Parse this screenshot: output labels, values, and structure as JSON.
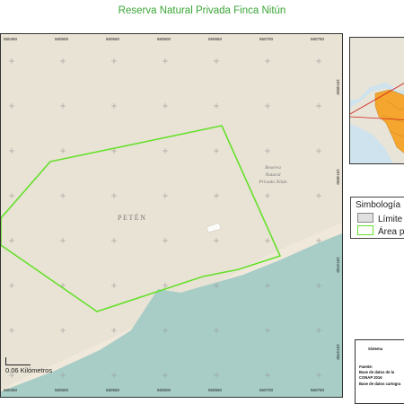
{
  "title": "Reserva Natural Privada Finca Nitún",
  "colors": {
    "title": "#3aa536",
    "land": "#e9e3d5",
    "water": "#a7cdc6",
    "boundary": "#66e02b",
    "inset_land": "#f4a62e"
  },
  "map": {
    "x_ticks": [
      "560450",
      "560500",
      "560550",
      "560600",
      "560650",
      "560700",
      "560750"
    ],
    "y_ticks": [
      "1874850",
      "1874800",
      "1874750",
      "1874700"
    ],
    "region_label": "PETÉN",
    "reserve_label_lines": [
      "Reserva",
      "Natural",
      "Privada Nitún"
    ],
    "scale_label": "0.06 Kilómetros"
  },
  "legend": {
    "title": "Simbología",
    "items": [
      {
        "label": "Límite",
        "swatch_fill": "#e0e0e0",
        "swatch_border": "#888888"
      },
      {
        "label": "Área pr",
        "swatch_fill": "#ffffff",
        "swatch_border": "#66e02b"
      }
    ]
  },
  "info_box": {
    "heading": "Sistema",
    "source_label": "Fuente:",
    "lines": [
      "Base de datos de la",
      "CONAP 2016",
      "Base de datos cartogra"
    ]
  }
}
